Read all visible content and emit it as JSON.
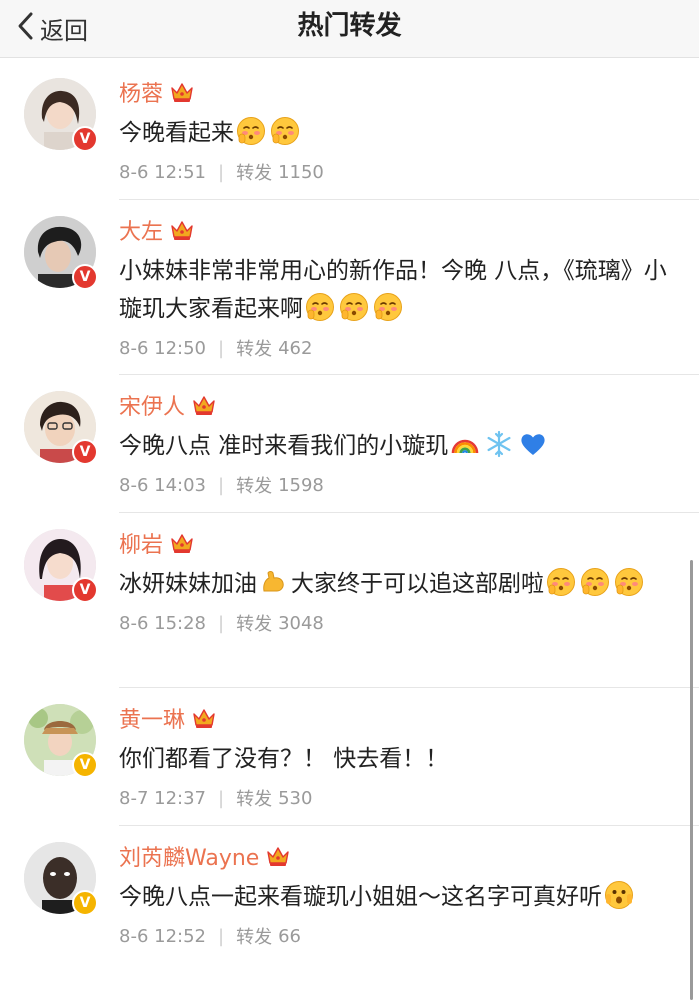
{
  "navbar": {
    "back_label": "返回",
    "title": "热门转发"
  },
  "colors": {
    "accent": "#eb7350",
    "vip_red": "#e3382f",
    "vip_gold": "#f5b400",
    "crown_gold": "#f2a81f"
  },
  "repost_label": "转发",
  "posts": [
    {
      "name": "杨蓉",
      "badge": "vip-red",
      "text_parts": [
        "今晚看起来",
        "[shy-emoji]",
        "[shy-emoji]"
      ],
      "time": "8-6 12:51",
      "reposts": "1150"
    },
    {
      "name": "大左",
      "badge": "vip-red",
      "text_parts": [
        "小妹妹非常非常用心的新作品！今晚 八点，《琉璃》小璇玑大家看起来啊",
        "[shy-emoji]",
        "[shy-emoji]",
        "[shy-emoji]"
      ],
      "time": "8-6 12:50",
      "reposts": "462"
    },
    {
      "name": "宋伊人",
      "badge": "vip-red",
      "text_parts": [
        "今晚八点 准时来看我们的小璇玑",
        "[rainbow-emoji]",
        "[snowflake-emoji]",
        "[blue-heart-emoji]"
      ],
      "time": "8-6 14:03",
      "reposts": "1598"
    },
    {
      "name": "柳岩",
      "badge": "vip-red",
      "text_parts": [
        "冰妍妹妹加油",
        "[muscle-emoji]",
        "大家终于可以追这部剧啦",
        "[shy-emoji]",
        "[shy-emoji]",
        "[shy-emoji]"
      ],
      "time": "8-6 15:28",
      "reposts": "3048"
    },
    {
      "name": "黄一琳",
      "badge": "vip-gold",
      "text_parts": [
        "你们都看了没有？！ 快去看！！"
      ],
      "time": "8-7 12:37",
      "reposts": "530"
    },
    {
      "name": "刘芮麟Wayne",
      "badge": "vip-gold",
      "text_parts": [
        "今晚八点一起来看璇玑小姐姐～这名字可真好听",
        "[surprised-emoji]"
      ],
      "time": "8-6 12:52",
      "reposts": "66"
    }
  ]
}
